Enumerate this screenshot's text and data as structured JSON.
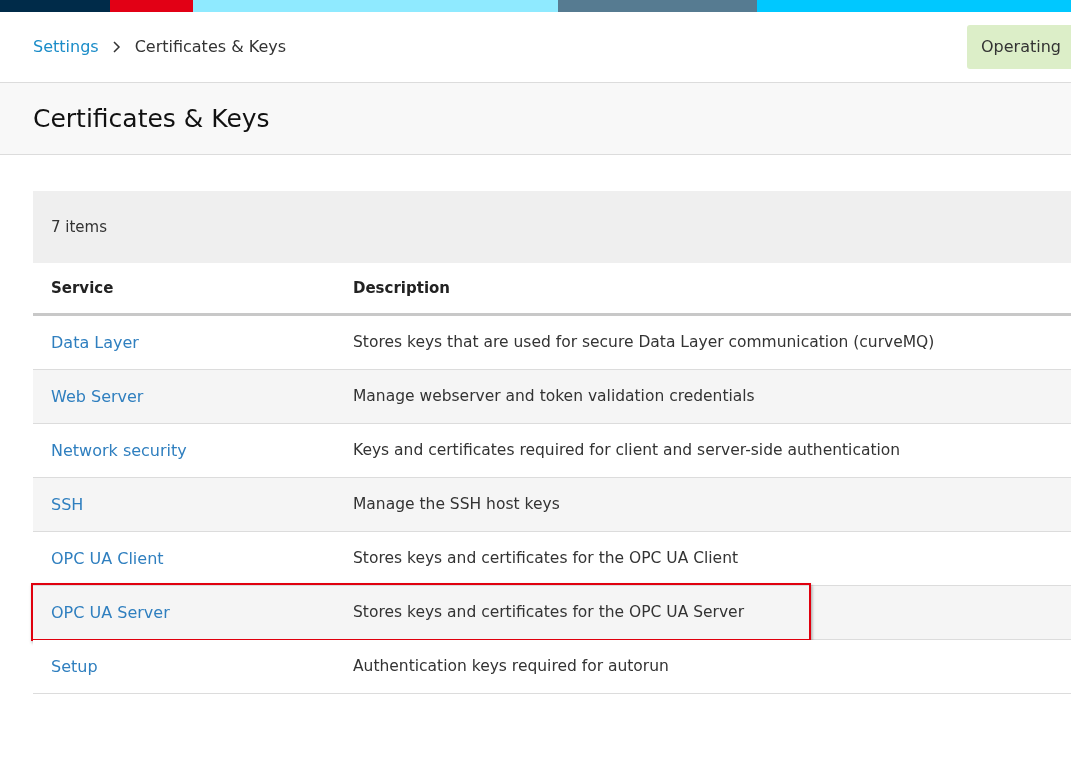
{
  "breadcrumb": {
    "items": [
      {
        "label": "Settings",
        "kind": "link"
      },
      {
        "label": "Certificates & Keys",
        "kind": "current"
      }
    ]
  },
  "status_badge": "Operating",
  "page_title": "Certificates & Keys",
  "table": {
    "count": "7 items",
    "columns": [
      "Service",
      "Description"
    ],
    "rows": [
      {
        "service": "Data Layer",
        "description": "Stores keys that are used for secure Data Layer communication (curveMQ)",
        "highlighted": false
      },
      {
        "service": "Web Server",
        "description": "Manage webserver and token validation credentials",
        "highlighted": false
      },
      {
        "service": "Network security",
        "description": "Keys and certificates required for client and server-side authentication",
        "highlighted": false
      },
      {
        "service": "SSH",
        "description": "Manage the SSH host keys",
        "highlighted": false
      },
      {
        "service": "OPC UA Client",
        "description": "Stores keys and certificates for the OPC UA Client",
        "highlighted": false
      },
      {
        "service": "OPC UA Server",
        "description": "Stores keys and certificates for the OPC UA Server",
        "highlighted": true
      },
      {
        "service": "Setup",
        "description": "Authentication keys required for autorun",
        "highlighted": false
      }
    ]
  }
}
